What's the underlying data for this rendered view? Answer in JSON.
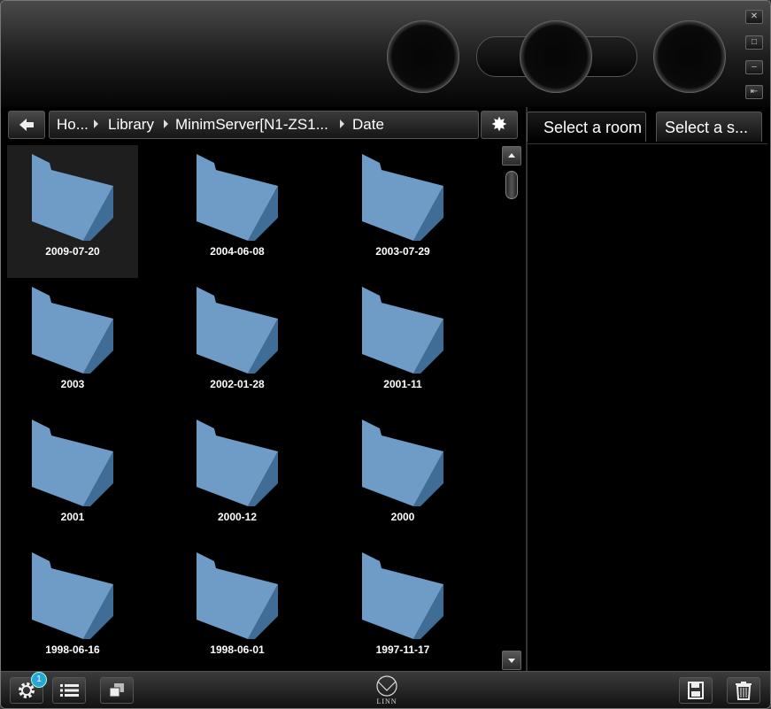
{
  "window_controls": {
    "close_icon": "close-icon",
    "maximize_icon": "maximize-icon",
    "minimize_icon": "minimize-icon",
    "collapse_icon": "collapse-icon"
  },
  "navigation": {
    "breadcrumbs": [
      "Ho...",
      "Library",
      "MinimServer[N1-ZS1...",
      "Date"
    ],
    "add_label": "+"
  },
  "folders": [
    {
      "label": "2009-07-20",
      "selected": true
    },
    {
      "label": "2004-06-08"
    },
    {
      "label": "2003-07-29"
    },
    {
      "label": "2003"
    },
    {
      "label": "2002-01-28"
    },
    {
      "label": "2001-11"
    },
    {
      "label": "2001"
    },
    {
      "label": "2000-12"
    },
    {
      "label": "2000"
    },
    {
      "label": "1998-06-16"
    },
    {
      "label": "1998-06-01"
    },
    {
      "label": "1997-11-17"
    }
  ],
  "right_panel": {
    "room_tab": "Select a room",
    "source_tab": "Select a s..."
  },
  "bottom_bar": {
    "settings_badge": "1",
    "logo_text": "LINN"
  },
  "colors": {
    "folder": "#5f8db8",
    "badge": "#2aa5d8",
    "background": "#000000"
  }
}
